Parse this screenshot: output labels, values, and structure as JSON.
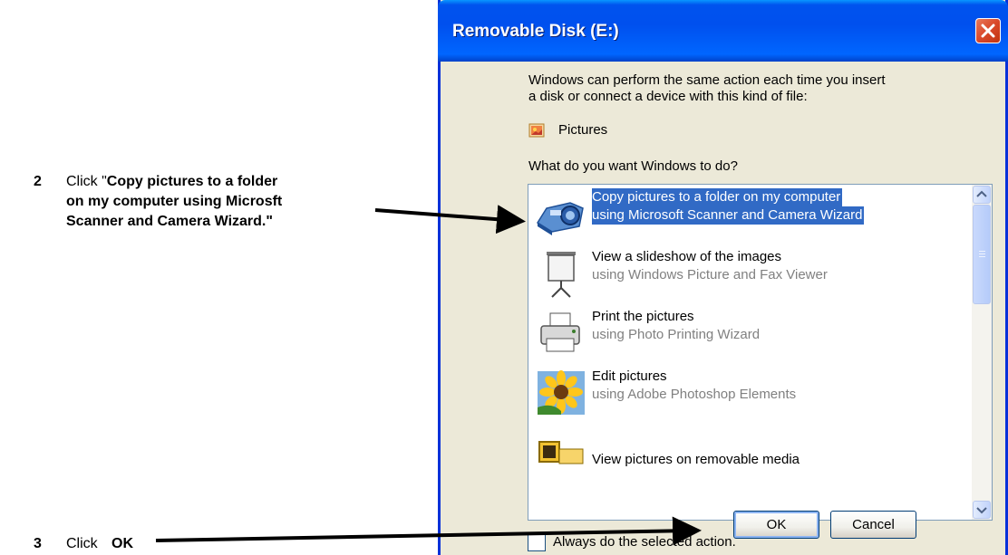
{
  "instructions": {
    "step2": {
      "number": "2",
      "prefix": "Click \"",
      "bold_line1": "Copy pictures to a folder",
      "bold_line2": "on my computer using Microsft",
      "bold_line3": "Scanner and Camera Wizard.\""
    },
    "step3": {
      "number": "3",
      "prefix": "Click",
      "bold": "OK"
    }
  },
  "dialog": {
    "title": "Removable Disk (E:)",
    "intro_line1": "Windows can perform the same action each time you insert",
    "intro_line2": "a disk or connect a device with this kind of file:",
    "file_type": "Pictures",
    "question": "What do you want Windows to do?",
    "actions": [
      {
        "title": "Copy pictures to a folder on my computer",
        "subtitle": "using Microsoft Scanner and Camera Wizard",
        "icon": "camera-wizard-icon",
        "selected": true
      },
      {
        "title": "View a slideshow of the images",
        "subtitle": "using Windows Picture and Fax Viewer",
        "icon": "projector-screen-icon",
        "selected": false
      },
      {
        "title": "Print the pictures",
        "subtitle": "using Photo Printing Wizard",
        "icon": "printer-icon",
        "selected": false
      },
      {
        "title": "Edit pictures",
        "subtitle": "using Adobe Photoshop Elements",
        "icon": "sunflower-icon",
        "selected": false
      },
      {
        "title": "View pictures on removable media",
        "subtitle": "",
        "icon": "picture-folder-icon",
        "selected": false
      }
    ],
    "always_checkbox": {
      "label": "Always do the selected action.",
      "checked": false
    },
    "ok_label": "OK",
    "cancel_label": "Cancel"
  },
  "colors": {
    "title_bar": "#0053ee",
    "dialog_bg": "#ece9d8",
    "selection": "#316ac5",
    "close_button": "#d9482a"
  }
}
